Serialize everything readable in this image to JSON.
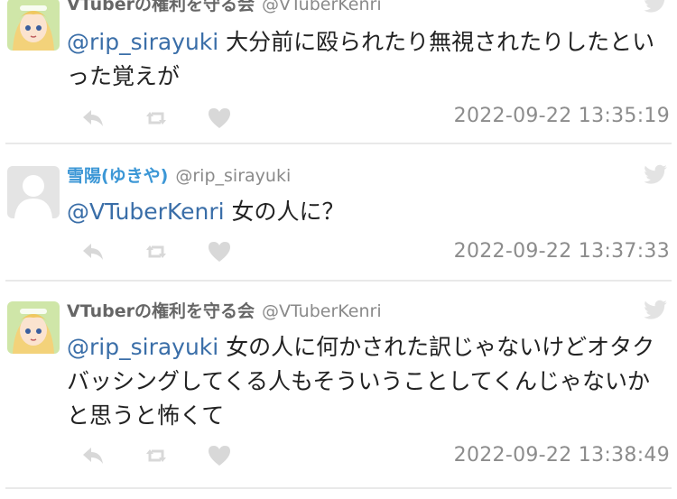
{
  "tweets": [
    {
      "display_name": "VTuberの権利を守る会",
      "handle": "@VTuberKenri",
      "mention": "@rip_sirayuki",
      "text": " 大分前に殴られたり無視されたりしたといった覚えが",
      "timestamp": "2022-09-22 13:35:19",
      "avatar": "anime-character"
    },
    {
      "display_name": "雪陽(ゆきや)",
      "handle": "@rip_sirayuki",
      "mention": "@VTuberKenri",
      "text": " 女の人に？",
      "timestamp": "2022-09-22 13:37:33",
      "avatar": "default-silhouette"
    },
    {
      "display_name": "VTuberの権利を守る会",
      "handle": "@VTuberKenri",
      "mention": "@rip_sirayuki",
      "text": " 女の人に何かされた訳じゃないけどオタクバッシングしてくる人もそういうことしてくんじゃないかと思うと怖くて",
      "timestamp": "2022-09-22 13:38:49",
      "avatar": "anime-character"
    }
  ],
  "icons": {
    "reply": "reply-icon",
    "retweet": "retweet-icon",
    "like": "heart-icon",
    "brand": "bird-icon"
  },
  "colors": {
    "mention": "#3a6ea8",
    "name_highlight": "#3c97d6",
    "meta_gray": "#8c8c8c",
    "icon_gray": "#d8d8d8"
  }
}
